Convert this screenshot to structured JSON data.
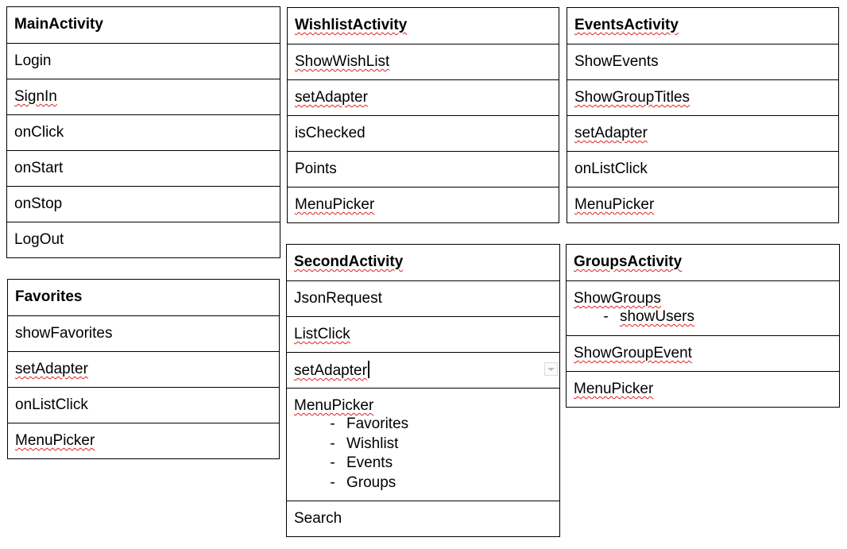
{
  "main_activity": {
    "title": "MainActivity",
    "items": [
      "Login",
      "SignIn",
      "onClick",
      "onStart",
      "onStop",
      "LogOut"
    ]
  },
  "favorites": {
    "title": "Favorites",
    "items": [
      "showFavorites",
      "setAdapter",
      "onListClick",
      "MenuPicker"
    ]
  },
  "wishlist_activity": {
    "title": "WishlistActivity",
    "items": [
      "ShowWishList",
      "setAdapter",
      "isChecked",
      "Points",
      "MenuPicker"
    ]
  },
  "second_activity": {
    "title": "SecondActivity",
    "items": [
      "JsonRequest",
      "ListClick",
      "setAdapter"
    ],
    "menu": {
      "label": "MenuPicker",
      "bullet": "-",
      "subitems": [
        "Favorites",
        "Wishlist",
        "Events",
        "Groups"
      ]
    },
    "last": "Search"
  },
  "events_activity": {
    "title": "EventsActivity",
    "items": [
      "ShowEvents",
      "ShowGroupTitles",
      "setAdapter",
      "onListClick",
      "MenuPicker"
    ]
  },
  "groups_activity": {
    "title": "GroupsActivity",
    "show_groups": {
      "label": "ShowGroups",
      "bullet": "-",
      "sub": "showUsers"
    },
    "items": [
      "ShowGroupEvent",
      "MenuPicker"
    ]
  }
}
